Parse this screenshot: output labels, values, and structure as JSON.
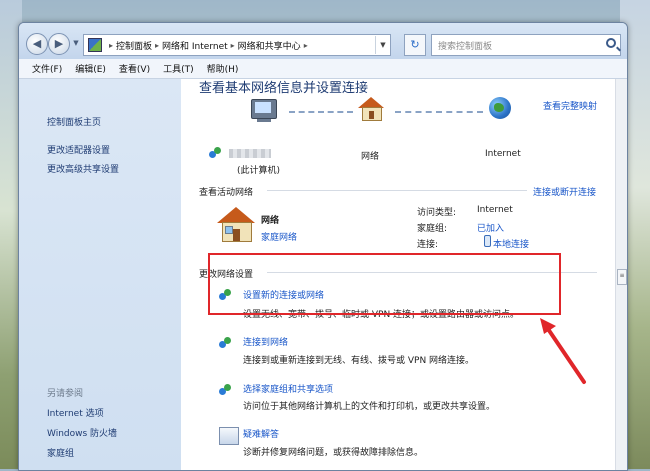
{
  "window": {
    "breadcrumb": [
      "控制面板",
      "网络和 Internet",
      "网络和共享中心"
    ],
    "search_placeholder": "搜索控制面板"
  },
  "menu": [
    "文件(F)",
    "编辑(E)",
    "查看(V)",
    "工具(T)",
    "帮助(H)"
  ],
  "sidebar": {
    "home": "控制面板主页",
    "links": [
      "更改适配器设置",
      "更改高级共享设置"
    ],
    "see_also_label": "另请参阅",
    "see_also": [
      "Internet 选项",
      "Windows 防火墙",
      "家庭组"
    ]
  },
  "main": {
    "title": "查看基本网络信息并设置连接",
    "full_map": "查看完整映射",
    "map": {
      "this_pc": "(此计算机)",
      "network": "网络",
      "internet": "Internet"
    },
    "active_label": "查看活动网络",
    "connect_disconnect": "连接或断开连接",
    "active_network": {
      "name": "网络",
      "type": "家庭网络",
      "access_type_label": "访问类型:",
      "access_type_value": "Internet",
      "homegroup_label": "家庭组:",
      "homegroup_value": "已加入",
      "connections_label": "连接:",
      "connections_value": "本地连接"
    },
    "change_label": "更改网络设置",
    "options": [
      {
        "title": "设置新的连接或网络",
        "desc": "设置无线、宽带、拨号、临时或 VPN 连接；或设置路由器或访问点。"
      },
      {
        "title": "连接到网络",
        "desc": "连接到或重新连接到无线、有线、拨号或 VPN 网络连接。"
      },
      {
        "title": "选择家庭组和共享选项",
        "desc": "访问位于其他网络计算机上的文件和打印机，或更改共享设置。"
      },
      {
        "title": "疑难解答",
        "desc": "诊断并修复网络问题，或获得故障排除信息。"
      }
    ]
  },
  "colors": {
    "highlight": "#e0262a",
    "link": "#1a57c9"
  }
}
